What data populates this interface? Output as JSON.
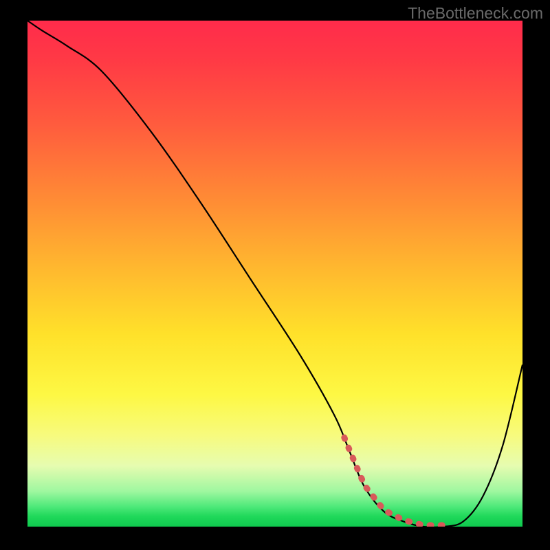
{
  "attribution": "TheBottleneck.com",
  "chart_data": {
    "type": "line",
    "title": "",
    "xlabel": "",
    "ylabel": "",
    "xlim": [
      0,
      100
    ],
    "ylim": [
      0,
      100
    ],
    "series": [
      {
        "name": "bottleneck-curve",
        "x": [
          0,
          3,
          8,
          15,
          25,
          35,
          45,
          55,
          62,
          65,
          68,
          72,
          76,
          80,
          84,
          88,
          92,
          96,
          100
        ],
        "values": [
          100,
          98,
          95,
          90,
          78,
          64,
          49,
          34,
          22,
          15,
          8,
          3,
          1,
          0,
          0,
          1,
          6,
          16,
          32
        ]
      }
    ],
    "annotation": {
      "name": "selected-range",
      "x_range": [
        64,
        85
      ],
      "style": "red-dotted"
    },
    "colors": {
      "gradient_top": "#ff2b4b",
      "gradient_mid": "#ffe12a",
      "gradient_bottom": "#0fc94e",
      "curve": "#000000",
      "dotted": "#d85a5a"
    }
  }
}
